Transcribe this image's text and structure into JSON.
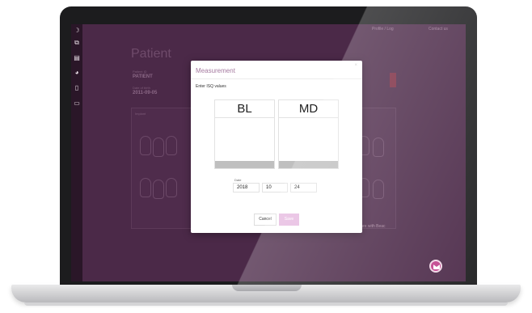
{
  "topbar": {
    "links": [
      "Profile / Log",
      "Contact us"
    ]
  },
  "sidebar": {
    "icons": [
      "moon-icon",
      "copy-icon",
      "document-icon",
      "palette-icon",
      "file-icon",
      "monitor-icon"
    ]
  },
  "page": {
    "title": "Patient",
    "fields": [
      {
        "label": "Patient ID",
        "value": "PATIENT"
      },
      {
        "label": "Date of birth",
        "value": "2011-09-05"
      }
    ],
    "card_label": "Implant",
    "footer_right": "Measure with Beac"
  },
  "modal": {
    "title": "Measurement",
    "subtitle": "Enter ISQ values",
    "columns": [
      {
        "label": "BL",
        "value": ""
      },
      {
        "label": "MD",
        "value": ""
      }
    ],
    "date_label": "Date",
    "date": {
      "year": "2018",
      "month": "10",
      "day": "24"
    },
    "cancel_label": "Cancel",
    "save_label": "Save"
  },
  "colors": {
    "accent": "#a57aa0",
    "background": "#4b2948",
    "fab": "#c0408b"
  }
}
